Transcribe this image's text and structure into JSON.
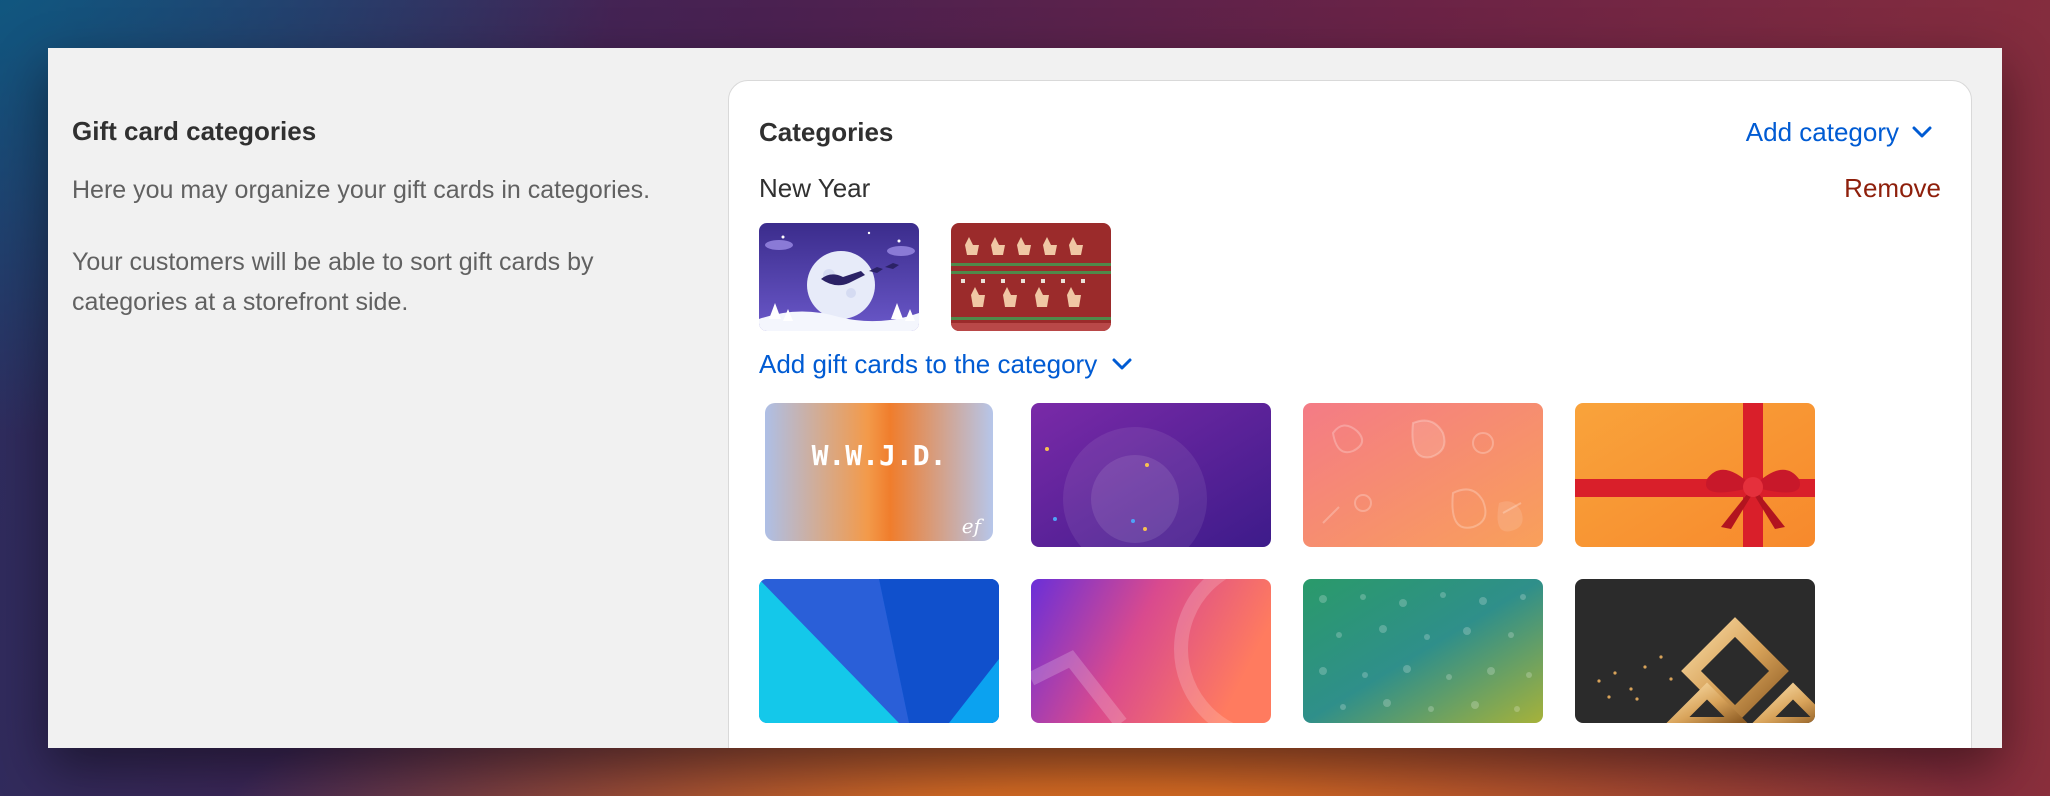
{
  "left": {
    "title": "Gift card categories",
    "description_1": "Here you may organize your gift cards in categories.",
    "description_2": "Your customers will be able to sort gift cards by categories at a storefront side."
  },
  "panel": {
    "title": "Categories",
    "add_category_label": "Add category",
    "category": {
      "name": "New Year",
      "remove_label": "Remove",
      "assigned_cards": [
        "moon-sleigh-card",
        "reindeer-sweater-card"
      ]
    },
    "add_gift_cards_label": "Add gift cards to the category",
    "gift_card_watermark": "W.W.J.D.",
    "available_cards": [
      "wwjd-gradient-card",
      "purple-circles-card",
      "coral-doodle-card",
      "orange-ribbon-card",
      "blue-geometric-card",
      "purple-coral-gradient-card",
      "green-pattern-card",
      "dark-gold-diamond-card"
    ]
  },
  "colors": {
    "link": "#005bd3",
    "remove": "#8e1f0b",
    "heading": "#303030",
    "body_text": "#616161"
  },
  "icons": {
    "add_category": "chevron-down-icon",
    "add_gift_cards": "chevron-down-icon"
  }
}
